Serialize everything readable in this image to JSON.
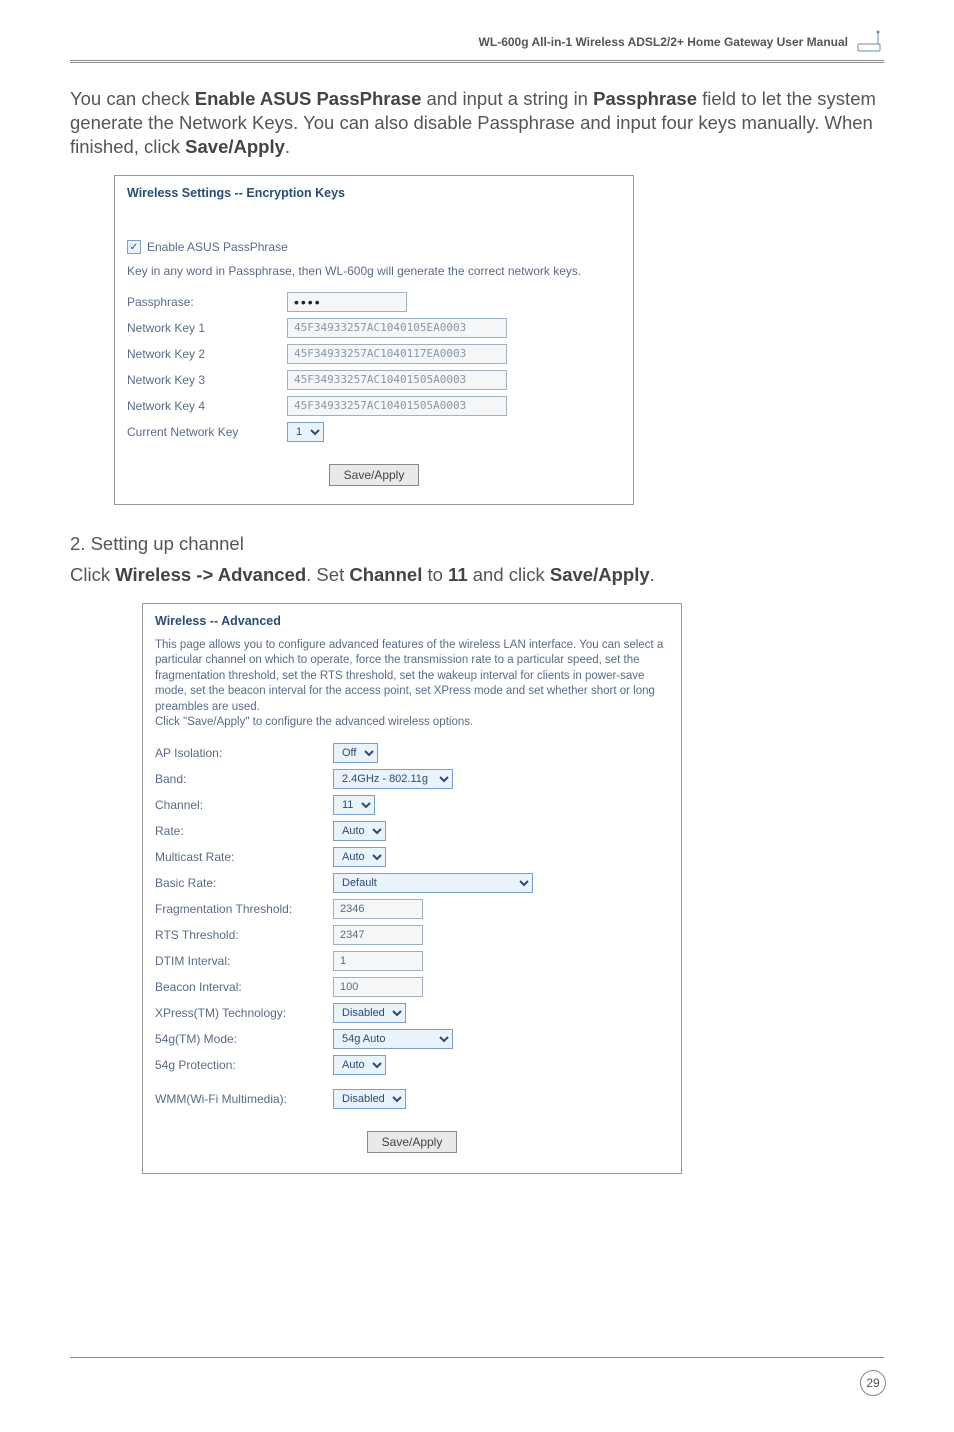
{
  "header": {
    "title": "WL-600g All-in-1 Wireless ADSL2/2+ Home Gateway User Manual"
  },
  "intro": {
    "part1": "You can check ",
    "bold1": "Enable ASUS PassPhrase",
    "part2": " and input a string in ",
    "bold2": "Passphrase",
    "part3": " field to let the system generate the Network Keys. You can also disable Passphrase and input four keys manually. When finished, click ",
    "bold3": "Save/Apply",
    "part4": "."
  },
  "shot1": {
    "title": "Wireless Settings -- Encryption Keys",
    "enable_checkbox_label": "Enable ASUS PassPhrase",
    "note": "Key in any word in Passphrase, then WL-600g will generate the correct network keys.",
    "labels": {
      "passphrase": "Passphrase:",
      "key1": "Network Key 1",
      "key2": "Network Key 2",
      "key3": "Network Key 3",
      "key4": "Network Key 4",
      "current": "Current Network Key"
    },
    "values": {
      "passphrase": "••••",
      "key1": "45F34933257AC1040105EA0003",
      "key2": "45F34933257AC1040117EA0003",
      "key3": "45F34933257AC10401505A0003",
      "key4": "45F34933257AC10401505A0003",
      "current": "1"
    },
    "button": "Save/Apply"
  },
  "step2": "2.   Setting up channel",
  "click_line": {
    "p1": "Click ",
    "b1": "Wireless -> Advanced",
    "p2": ". Set ",
    "b2": "Channel",
    "p3": " to ",
    "b3": "11",
    "p4": " and click ",
    "b4": "Save/Apply",
    "p5": "."
  },
  "shot2": {
    "title": "Wireless -- Advanced",
    "desc": "This page allows you to configure advanced features of the wireless LAN interface. You can select a particular channel on which to operate, force the transmission rate to a particular speed, set the fragmentation threshold, set the RTS threshold, set the wakeup interval for clients in power-save mode, set the beacon interval for the access point, set XPress mode and set whether short or long preambles are used.\nClick \"Save/Apply\" to configure the advanced wireless options.",
    "labels": {
      "ap": "AP Isolation:",
      "band": "Band:",
      "channel": "Channel:",
      "rate": "Rate:",
      "multicast": "Multicast Rate:",
      "basic": "Basic Rate:",
      "frag": "Fragmentation Threshold:",
      "rts": "RTS Threshold:",
      "dtim": "DTIM Interval:",
      "beacon": "Beacon Interval:",
      "xpress": "XPress(TM) Technology:",
      "mode": "54g(TM) Mode:",
      "protection": "54g Protection:",
      "wmm": "WMM(Wi-Fi Multimedia):"
    },
    "values": {
      "ap": "Off",
      "band": "2.4GHz - 802.11g",
      "channel": "11",
      "rate": "Auto",
      "multicast": "Auto",
      "basic": "Default",
      "frag": "2346",
      "rts": "2347",
      "dtim": "1",
      "beacon": "100",
      "xpress": "Disabled",
      "mode": "54g Auto",
      "protection": "Auto",
      "wmm": "Disabled"
    },
    "button": "Save/Apply"
  },
  "page_number": "29"
}
